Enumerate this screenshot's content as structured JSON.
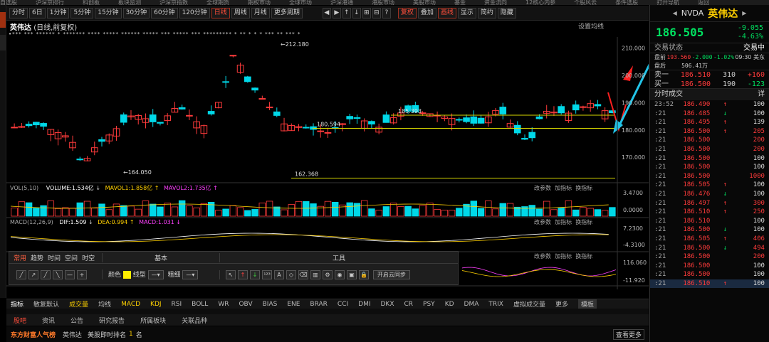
{
  "top_menu": [
    "自选股",
    "沪深京排行",
    "科创板",
    "板块监测",
    "沪深京指数",
    "全球期货",
    "期权市场",
    "全球市场",
    "沪深港通",
    "港股市场",
    "美股市场",
    "基金",
    "资金流向",
    "12核心内参",
    "个股风云",
    "条件选股",
    "打开导航",
    "返回"
  ],
  "left_tabs": [
    "",
    "自",
    "选"
  ],
  "toolbar": {
    "items": [
      "分时",
      "6日",
      "1分钟",
      "5分钟",
      "15分钟",
      "30分钟",
      "60分钟",
      "120分钟",
      "日线",
      "周线",
      "月线",
      "更多周期"
    ],
    "active": "日线",
    "right_items": [
      "复权",
      "叠加",
      "画线",
      "显示",
      "简约",
      "隐藏"
    ],
    "right_active": [
      "复权",
      "画线"
    ]
  },
  "chart": {
    "name": "英伟达",
    "mode": "(日线,前复权)",
    "ma_label": "设置均线",
    "high_label": "212.180",
    "low_label": "164.050",
    "line1_label": "185.393",
    "line2_label": "180.594",
    "line3_label": "162.368"
  },
  "markers": "•*** *** ****** * ******* **** ***** ****** ***** *** ***** *** ********* * ** * * * *** ** *** *",
  "vol": {
    "label": "VOL(5,10)",
    "volume": "VOLUME:1.534亿",
    "mavol1": "MAVOL1:1.858亿",
    "mavol2": "MAVOL2:1.735亿",
    "params": "改参数",
    "add": "加指标",
    "switch": "换指标"
  },
  "macd": {
    "label": "MACD(12,26,9)",
    "dif": "DIF:1.509",
    "dea": "DEA:0.994",
    "macd": "MACD:1.031"
  },
  "toolpanel": {
    "tabs": [
      "常用",
      "趋势",
      "时间",
      "空间",
      "时空"
    ],
    "basic": "基本",
    "tools": "工具",
    "color": "颜色",
    "linetype": "线型",
    "thickness": "粗细",
    "cloud": "开启云同步"
  },
  "axis_x": [
    "08",
    "09",
    "10",
    "11",
    "12",
    "2026",
    "02"
  ],
  "price_axis": [
    "210.000",
    "200.000",
    "190.000",
    "180.000",
    "170.000"
  ],
  "vol_axis": [
    "3.4700",
    "0.0000"
  ],
  "macd_axis": [
    "7.2300",
    "-4.3100"
  ],
  "ind3_axis": [
    "116.060",
    "-11.920"
  ],
  "indicators": [
    "指标",
    "敏复默认",
    "成交量",
    "均线",
    "MACD",
    "KDJ",
    "RSI",
    "BOLL",
    "WR",
    "OBV",
    "BIAS",
    "ENE",
    "BRAR",
    "CCI",
    "DMI",
    "DKX",
    "CR",
    "PSY",
    "KD",
    "DMA",
    "TRIX",
    "虚拟成交量",
    "更多",
    "模板"
  ],
  "bottom_tabs": [
    "股吧",
    "资讯",
    "公告",
    "研究报告",
    "所属板块",
    "关联品种"
  ],
  "bottom_info": {
    "brand": "东方财富人气榜",
    "stock": "英伟达",
    "rank_label": "美股即时排名",
    "rank": "1",
    "rank_unit": "名",
    "more": "查看更多"
  },
  "quote": {
    "code": "NVDA",
    "name": "英伟达",
    "price": "186.505",
    "change": "-9.055",
    "pct": "-4.63%",
    "status_label": "交易状态",
    "status": "交易中",
    "premarket_label": "盘前",
    "pm_price": "193.560",
    "pm_change": "-2.000",
    "pm_pct": "-1.02%",
    "pm_time": "09:30 美东",
    "after_label": "盘后",
    "after_vol": "506.41万",
    "ask_label": "卖一",
    "ask_price": "186.510",
    "ask_vol": "310",
    "ask_delta": "+160",
    "bid_label": "买一",
    "bid_price": "186.500",
    "bid_vol": "190",
    "bid_delta": "-123",
    "ticks_label": "分时成交",
    "detail": "详"
  },
  "ticks": [
    {
      "t": "23:52",
      "p": "186.490",
      "d": "up",
      "v": "100"
    },
    {
      "t": ":21",
      "p": "186.485",
      "d": "dn",
      "v": "100"
    },
    {
      "t": ":21",
      "p": "186.495",
      "d": "up",
      "v": "139"
    },
    {
      "t": ":21",
      "p": "186.500",
      "d": "up",
      "v": "205"
    },
    {
      "t": ":21",
      "p": "186.500",
      "d": "",
      "v": "200"
    },
    {
      "t": ":21",
      "p": "186.500",
      "d": "",
      "v": "200"
    },
    {
      "t": ":21",
      "p": "186.500",
      "d": "",
      "v": "100"
    },
    {
      "t": ":21",
      "p": "186.500",
      "d": "",
      "v": "100"
    },
    {
      "t": ":21",
      "p": "186.500",
      "d": "",
      "v": "1000"
    },
    {
      "t": ":21",
      "p": "186.505",
      "d": "up",
      "v": "100"
    },
    {
      "t": ":21",
      "p": "186.476",
      "d": "dn",
      "v": "100"
    },
    {
      "t": ":21",
      "p": "186.497",
      "d": "up",
      "v": "300"
    },
    {
      "t": ":21",
      "p": "186.510",
      "d": "up",
      "v": "250"
    },
    {
      "t": ":21",
      "p": "186.510",
      "d": "",
      "v": "100"
    },
    {
      "t": ":21",
      "p": "186.500",
      "d": "dn",
      "v": "100"
    },
    {
      "t": ":21",
      "p": "186.505",
      "d": "up",
      "v": "406"
    },
    {
      "t": ":21",
      "p": "186.500",
      "d": "dn",
      "v": "494"
    },
    {
      "t": ":21",
      "p": "186.500",
      "d": "",
      "v": "200"
    },
    {
      "t": ":21",
      "p": "186.500",
      "d": "",
      "v": "100"
    },
    {
      "t": ":21",
      "p": "186.500",
      "d": "",
      "v": "100"
    },
    {
      "t": ":21",
      "p": "186.510",
      "d": "up",
      "v": "100"
    }
  ],
  "colors": {
    "up": "#ff3b3b",
    "down": "#00d8e8",
    "yellow": "#e8e800",
    "accent": "#ff4d3a"
  }
}
